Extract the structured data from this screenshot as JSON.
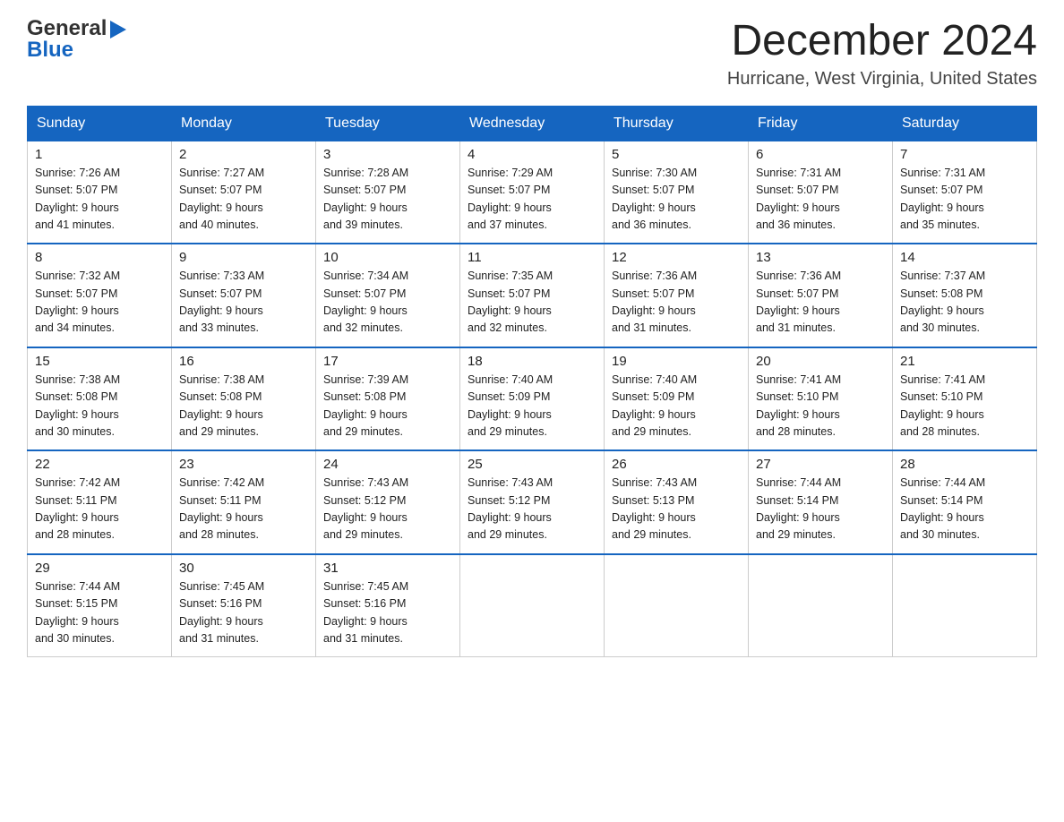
{
  "header": {
    "logo_general": "General",
    "logo_blue": "Blue",
    "month_title": "December 2024",
    "location": "Hurricane, West Virginia, United States"
  },
  "days_of_week": [
    "Sunday",
    "Monday",
    "Tuesday",
    "Wednesday",
    "Thursday",
    "Friday",
    "Saturday"
  ],
  "weeks": [
    [
      {
        "day": "1",
        "sunrise": "7:26 AM",
        "sunset": "5:07 PM",
        "daylight": "9 hours and 41 minutes."
      },
      {
        "day": "2",
        "sunrise": "7:27 AM",
        "sunset": "5:07 PM",
        "daylight": "9 hours and 40 minutes."
      },
      {
        "day": "3",
        "sunrise": "7:28 AM",
        "sunset": "5:07 PM",
        "daylight": "9 hours and 39 minutes."
      },
      {
        "day": "4",
        "sunrise": "7:29 AM",
        "sunset": "5:07 PM",
        "daylight": "9 hours and 37 minutes."
      },
      {
        "day": "5",
        "sunrise": "7:30 AM",
        "sunset": "5:07 PM",
        "daylight": "9 hours and 36 minutes."
      },
      {
        "day": "6",
        "sunrise": "7:31 AM",
        "sunset": "5:07 PM",
        "daylight": "9 hours and 36 minutes."
      },
      {
        "day": "7",
        "sunrise": "7:31 AM",
        "sunset": "5:07 PM",
        "daylight": "9 hours and 35 minutes."
      }
    ],
    [
      {
        "day": "8",
        "sunrise": "7:32 AM",
        "sunset": "5:07 PM",
        "daylight": "9 hours and 34 minutes."
      },
      {
        "day": "9",
        "sunrise": "7:33 AM",
        "sunset": "5:07 PM",
        "daylight": "9 hours and 33 minutes."
      },
      {
        "day": "10",
        "sunrise": "7:34 AM",
        "sunset": "5:07 PM",
        "daylight": "9 hours and 32 minutes."
      },
      {
        "day": "11",
        "sunrise": "7:35 AM",
        "sunset": "5:07 PM",
        "daylight": "9 hours and 32 minutes."
      },
      {
        "day": "12",
        "sunrise": "7:36 AM",
        "sunset": "5:07 PM",
        "daylight": "9 hours and 31 minutes."
      },
      {
        "day": "13",
        "sunrise": "7:36 AM",
        "sunset": "5:07 PM",
        "daylight": "9 hours and 31 minutes."
      },
      {
        "day": "14",
        "sunrise": "7:37 AM",
        "sunset": "5:08 PM",
        "daylight": "9 hours and 30 minutes."
      }
    ],
    [
      {
        "day": "15",
        "sunrise": "7:38 AM",
        "sunset": "5:08 PM",
        "daylight": "9 hours and 30 minutes."
      },
      {
        "day": "16",
        "sunrise": "7:38 AM",
        "sunset": "5:08 PM",
        "daylight": "9 hours and 29 minutes."
      },
      {
        "day": "17",
        "sunrise": "7:39 AM",
        "sunset": "5:08 PM",
        "daylight": "9 hours and 29 minutes."
      },
      {
        "day": "18",
        "sunrise": "7:40 AM",
        "sunset": "5:09 PM",
        "daylight": "9 hours and 29 minutes."
      },
      {
        "day": "19",
        "sunrise": "7:40 AM",
        "sunset": "5:09 PM",
        "daylight": "9 hours and 29 minutes."
      },
      {
        "day": "20",
        "sunrise": "7:41 AM",
        "sunset": "5:10 PM",
        "daylight": "9 hours and 28 minutes."
      },
      {
        "day": "21",
        "sunrise": "7:41 AM",
        "sunset": "5:10 PM",
        "daylight": "9 hours and 28 minutes."
      }
    ],
    [
      {
        "day": "22",
        "sunrise": "7:42 AM",
        "sunset": "5:11 PM",
        "daylight": "9 hours and 28 minutes."
      },
      {
        "day": "23",
        "sunrise": "7:42 AM",
        "sunset": "5:11 PM",
        "daylight": "9 hours and 28 minutes."
      },
      {
        "day": "24",
        "sunrise": "7:43 AM",
        "sunset": "5:12 PM",
        "daylight": "9 hours and 29 minutes."
      },
      {
        "day": "25",
        "sunrise": "7:43 AM",
        "sunset": "5:12 PM",
        "daylight": "9 hours and 29 minutes."
      },
      {
        "day": "26",
        "sunrise": "7:43 AM",
        "sunset": "5:13 PM",
        "daylight": "9 hours and 29 minutes."
      },
      {
        "day": "27",
        "sunrise": "7:44 AM",
        "sunset": "5:14 PM",
        "daylight": "9 hours and 29 minutes."
      },
      {
        "day": "28",
        "sunrise": "7:44 AM",
        "sunset": "5:14 PM",
        "daylight": "9 hours and 30 minutes."
      }
    ],
    [
      {
        "day": "29",
        "sunrise": "7:44 AM",
        "sunset": "5:15 PM",
        "daylight": "9 hours and 30 minutes."
      },
      {
        "day": "30",
        "sunrise": "7:45 AM",
        "sunset": "5:16 PM",
        "daylight": "9 hours and 31 minutes."
      },
      {
        "day": "31",
        "sunrise": "7:45 AM",
        "sunset": "5:16 PM",
        "daylight": "9 hours and 31 minutes."
      },
      null,
      null,
      null,
      null
    ]
  ],
  "labels": {
    "sunrise": "Sunrise:",
    "sunset": "Sunset:",
    "daylight": "Daylight:"
  }
}
